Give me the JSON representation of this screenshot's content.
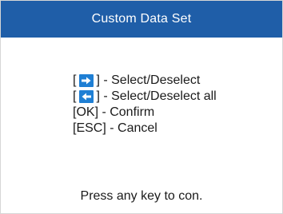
{
  "window": {
    "title": "Custom Data Set"
  },
  "instructions": [
    {
      "pre": "[",
      "icon": "right-arrow-icon",
      "post": "] - Select/Deselect"
    },
    {
      "pre": "[",
      "icon": "left-arrow-icon",
      "post": "] - Select/Deselect all"
    },
    {
      "text": "[OK] - Confirm"
    },
    {
      "text": "[ESC] - Cancel"
    }
  ],
  "footer": {
    "text": "Press any key to con."
  },
  "colors": {
    "title_bar": "#1f5ea8",
    "key_badge": "#1f7fd4"
  }
}
